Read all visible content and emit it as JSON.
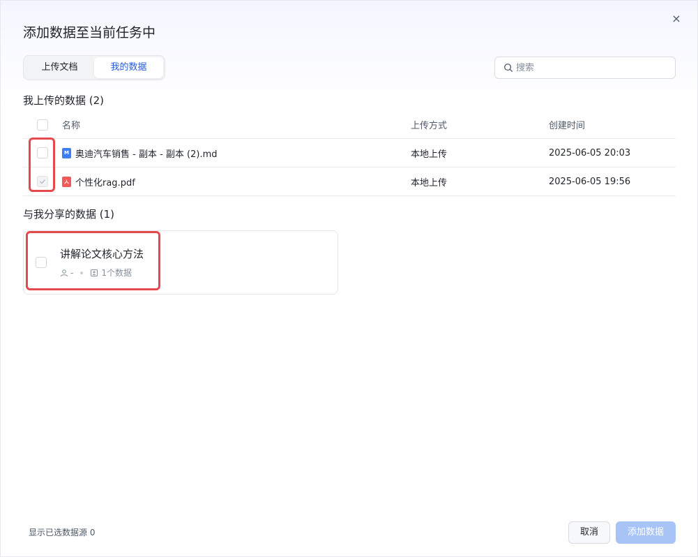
{
  "dialog": {
    "title": "添加数据至当前任务中",
    "close_glyph": "×"
  },
  "tabs": [
    {
      "label": "上传文档",
      "active": false
    },
    {
      "label": "我的数据",
      "active": true
    }
  ],
  "search": {
    "placeholder": "搜索",
    "value": ""
  },
  "uploaded": {
    "title": "我上传的数据 (2)",
    "columns": {
      "name": "名称",
      "method": "上传方式",
      "time": "创建时间"
    },
    "rows": [
      {
        "name": "奥迪汽车销售 - 副本 - 副本 (2).md",
        "type": "md",
        "icon": "markdown-file-icon",
        "method": "本地上传",
        "time": "2025-06-05 20:03",
        "checked": false
      },
      {
        "name": "个性化rag.pdf",
        "type": "pdf",
        "icon": "pdf-file-icon",
        "method": "本地上传",
        "time": "2025-06-05 19:56",
        "checked": true
      }
    ]
  },
  "shared": {
    "title": "与我分享的数据 (1)",
    "items": [
      {
        "name": "讲解论文核心方法",
        "owner": "-",
        "count": "1个数据"
      }
    ]
  },
  "footer": {
    "selected_text": "显示已选数据源 0",
    "cancel_label": "取消",
    "add_label": "添加数据"
  },
  "colors": {
    "accent": "#2a5bd7",
    "highlight": "#e5484d",
    "add_button_disabled": "#a8c4f7"
  }
}
